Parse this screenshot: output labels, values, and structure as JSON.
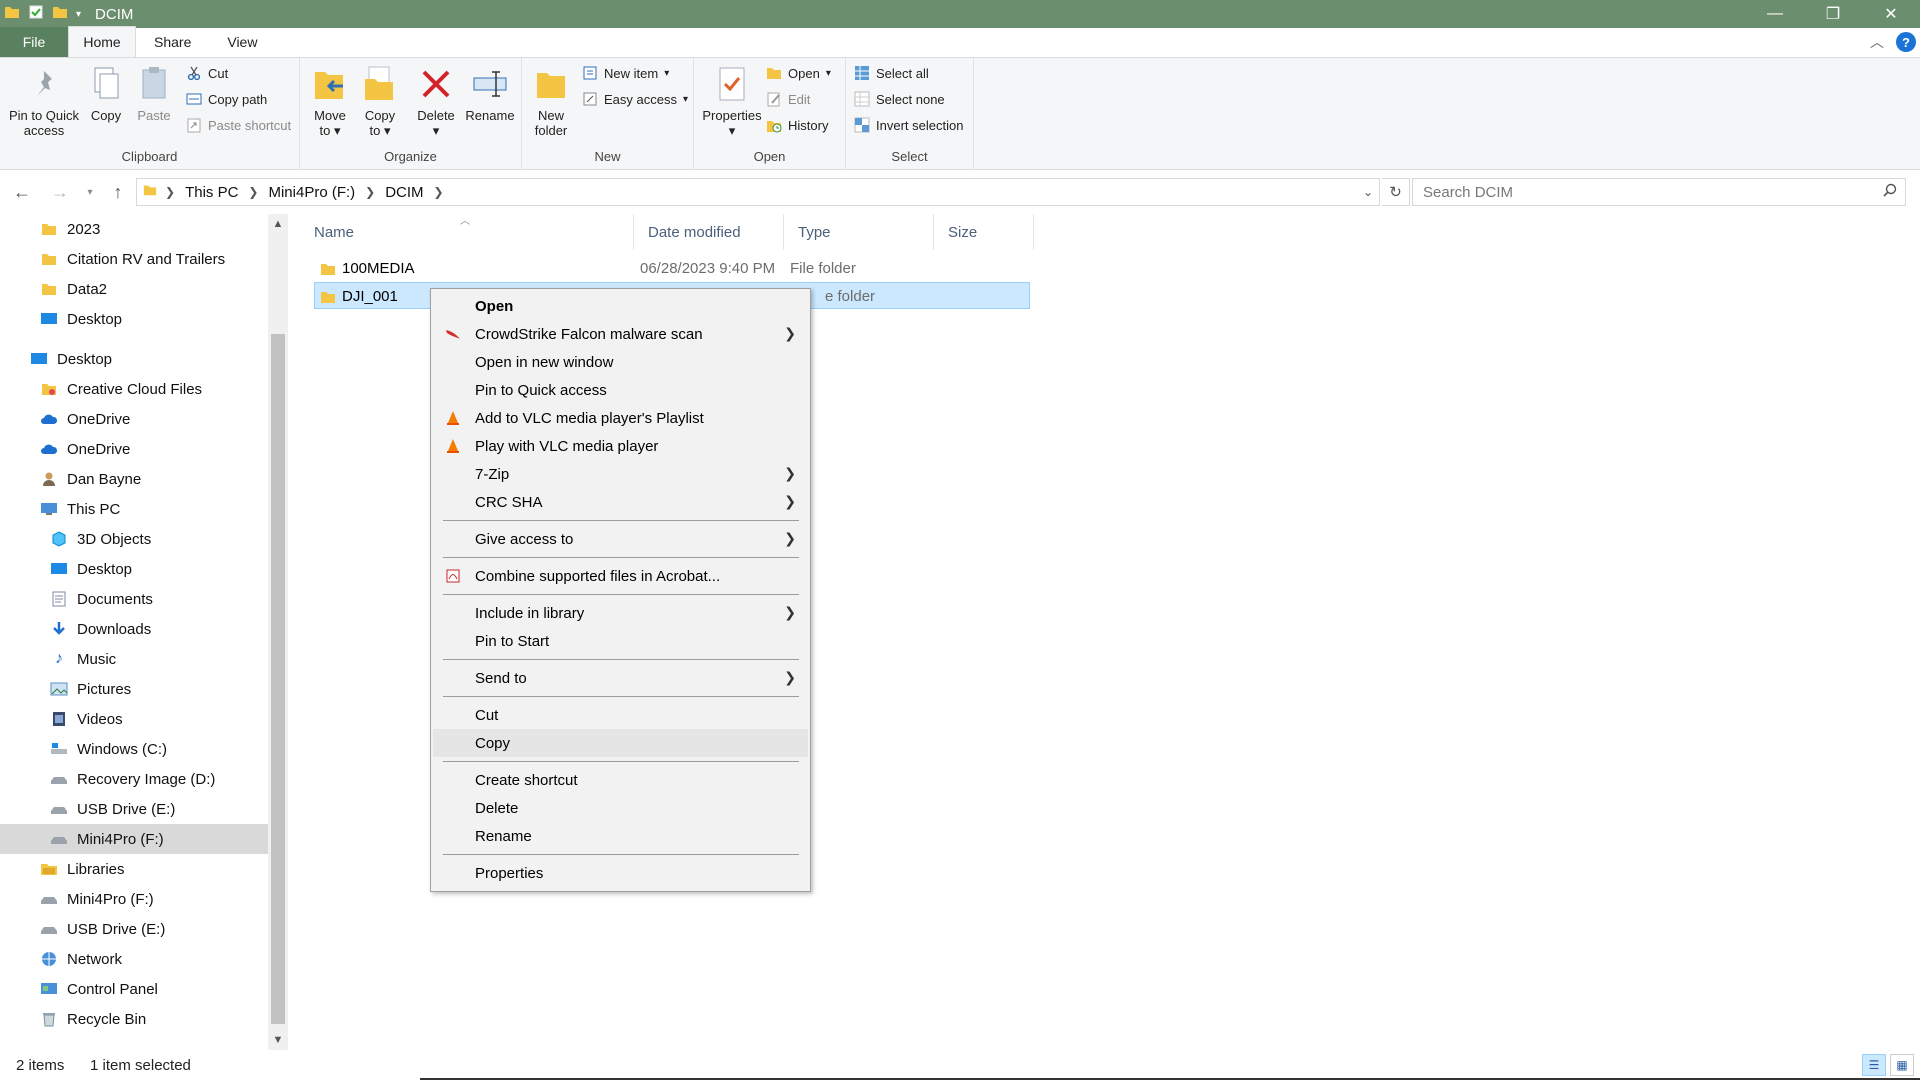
{
  "window": {
    "title": "DCIM",
    "controls": [
      "—",
      "❐",
      "✕"
    ]
  },
  "tabs": {
    "file": "File",
    "home": "Home",
    "share": "Share",
    "view": "View",
    "help": "?"
  },
  "ribbon": {
    "clipboard": {
      "label": "Clipboard",
      "pin_line1": "Pin to Quick",
      "pin_line2": "access",
      "copy": "Copy",
      "paste": "Paste",
      "cut": "Cut",
      "copy_path": "Copy path",
      "paste_shortcut": "Paste shortcut"
    },
    "organize": {
      "label": "Organize",
      "move_line1": "Move",
      "move_line2": "to",
      "copy_line1": "Copy",
      "copy_line2": "to",
      "delete": "Delete",
      "rename": "Rename"
    },
    "new": {
      "label": "New",
      "folder_line1": "New",
      "folder_line2": "folder",
      "new_item": "New item",
      "easy_access": "Easy access"
    },
    "open": {
      "label": "Open",
      "properties": "Properties",
      "open": "Open",
      "edit": "Edit",
      "history": "History"
    },
    "select": {
      "label": "Select",
      "select_all": "Select all",
      "select_none": "Select none",
      "invert": "Invert selection"
    }
  },
  "address": {
    "crumbs": [
      "This PC",
      "Mini4Pro (F:)",
      "DCIM"
    ],
    "search_placeholder": "Search DCIM"
  },
  "nav": {
    "items": [
      {
        "label": "2023",
        "icon": "folder-icon"
      },
      {
        "label": "Citation RV and Trailers",
        "icon": "folder-icon"
      },
      {
        "label": "Data2",
        "icon": "folder-icon"
      },
      {
        "label": "Desktop",
        "icon": "desktop-icon"
      },
      {
        "label": "Desktop",
        "icon": "desktop-icon"
      },
      {
        "label": "Creative Cloud Files",
        "icon": "creative-cloud-icon"
      },
      {
        "label": "OneDrive",
        "icon": "onedrive-icon"
      },
      {
        "label": "OneDrive",
        "icon": "onedrive-icon"
      },
      {
        "label": "Dan Bayne",
        "icon": "user-icon"
      },
      {
        "label": "This PC",
        "icon": "this-pc-icon"
      },
      {
        "label": "3D Objects",
        "icon": "3d-objects-icon"
      },
      {
        "label": "Desktop",
        "icon": "desktop-icon"
      },
      {
        "label": "Documents",
        "icon": "documents-icon"
      },
      {
        "label": "Downloads",
        "icon": "downloads-icon"
      },
      {
        "label": "Music",
        "icon": "music-icon"
      },
      {
        "label": "Pictures",
        "icon": "pictures-icon"
      },
      {
        "label": "Videos",
        "icon": "videos-icon"
      },
      {
        "label": "Windows (C:)",
        "icon": "drive-icon"
      },
      {
        "label": "Recovery Image (D:)",
        "icon": "drive-icon"
      },
      {
        "label": "USB Drive (E:)",
        "icon": "drive-icon"
      },
      {
        "label": "Mini4Pro (F:)",
        "icon": "drive-icon"
      },
      {
        "label": "Libraries",
        "icon": "libraries-icon"
      },
      {
        "label": "Mini4Pro (F:)",
        "icon": "drive-icon"
      },
      {
        "label": "USB Drive (E:)",
        "icon": "drive-icon"
      },
      {
        "label": "Network",
        "icon": "network-icon"
      },
      {
        "label": "Control Panel",
        "icon": "control-panel-icon"
      },
      {
        "label": "Recycle Bin",
        "icon": "recycle-bin-icon"
      }
    ]
  },
  "files": {
    "columns": [
      "Name",
      "Date modified",
      "Type",
      "Size"
    ],
    "rows": [
      {
        "name": "100MEDIA",
        "date": "06/28/2023 9:40 PM",
        "type": "File folder",
        "size": ""
      },
      {
        "name": "DJI_001",
        "date": "",
        "type": "e folder",
        "size": ""
      }
    ]
  },
  "context_menu": {
    "items": [
      {
        "label": "Open",
        "bold": true
      },
      {
        "label": "CrowdStrike Falcon malware scan",
        "icon": "crowdstrike-icon",
        "submenu": true
      },
      {
        "label": "Open in new window"
      },
      {
        "label": "Pin to Quick access"
      },
      {
        "label": "Add to VLC media player's Playlist",
        "icon": "vlc-icon"
      },
      {
        "label": "Play with VLC media player",
        "icon": "vlc-icon"
      },
      {
        "label": "7-Zip",
        "submenu": true
      },
      {
        "label": "CRC SHA",
        "submenu": true
      },
      {
        "label": "Give access to",
        "submenu": true
      },
      {
        "label": "Combine supported files in Acrobat...",
        "icon": "acrobat-icon"
      },
      {
        "label": "Include in library",
        "submenu": true
      },
      {
        "label": "Pin to Start"
      },
      {
        "label": "Send to",
        "submenu": true
      },
      {
        "label": "Cut"
      },
      {
        "label": "Copy",
        "hover": true
      },
      {
        "label": "Create shortcut"
      },
      {
        "label": "Delete"
      },
      {
        "label": "Rename"
      },
      {
        "label": "Properties"
      }
    ]
  },
  "status": {
    "count": "2 items",
    "selected": "1 item selected"
  },
  "colors": {
    "titlebar": "#6b8e6e",
    "file_tab": "#59815f",
    "selection": "#cce8ff",
    "folder": "#f4c542"
  }
}
